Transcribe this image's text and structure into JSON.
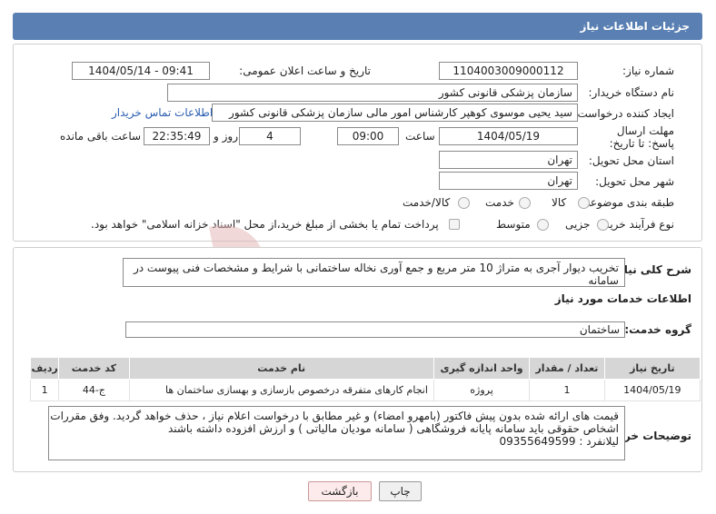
{
  "header": {
    "title": "جزئیات اطلاعات نیاز"
  },
  "form": {
    "need_number_label": "شماره نیاز:",
    "need_number": "1104003009000112",
    "announce_label": "تاریخ و ساعت اعلان عمومی:",
    "announce_value": "1404/05/14 - 09:41",
    "buyer_org_label": "نام دستگاه خریدار:",
    "buyer_org": "سازمان پزشکی قانونی کشور",
    "creator_label": "ایجاد کننده درخواست:",
    "creator": "سید یحیی موسوی کوهپر کارشناس امور مالی سازمان پزشکی قانونی کشور",
    "contact_link": "اطلاعات تماس خریدار",
    "deadline_label": "مهلت ارسال پاسخ: تا تاریخ:",
    "deadline_date": "1404/05/19",
    "time_label": "ساعت",
    "deadline_time": "09:00",
    "days_value": "4",
    "days_label": "روز و",
    "remaining_value": "22:35:49",
    "remaining_label": "ساعت باقی مانده",
    "province_label": "استان محل تحویل:",
    "province": "تهران",
    "city_label": "شهر محل تحویل:",
    "city": "تهران",
    "category_label": "طبقه بندی موضوعی:",
    "category_options": [
      "کالا",
      "خدمت",
      "کالا/خدمت"
    ],
    "process_label": "نوع فرآیند خرید :",
    "process_options": [
      "جزیی",
      "متوسط"
    ],
    "payment_note": "پرداخت تمام یا بخشی از مبلغ خرید،از محل \"اسناد خزانه اسلامی\" خواهد بود."
  },
  "details": {
    "summary_label": "شرح کلی نیاز:",
    "summary": "تخریب دیوار آجری به متراژ 10 متر مربع و جمع آوری نخاله ساختمانی با شرایط و مشخصات فنی  پیوست در سامانه",
    "services_title": "اطلاعات خدمات مورد نیاز",
    "group_label": "گروه خدمت:",
    "group_value": "ساختمان",
    "table": {
      "headers": [
        "ردیف",
        "کد خدمت",
        "نام خدمت",
        "واحد اندازه گیری",
        "تعداد / مقدار",
        "تاریخ نیاز"
      ],
      "rows": [
        [
          "1",
          "ج-44",
          "انجام کارهای متفرقه درخصوص بازسازی و بهسازی ساختمان ها",
          "پروژه",
          "1",
          "1404/05/19"
        ]
      ]
    },
    "buyer_notes_label": "توضیحات خریدار:",
    "buyer_notes": [
      "قیمت های ارائه شده بدون پیش فاکتور (بامهرو امضاء) و غیر مطابق با درخواست اعلام نیاز  ، حذف خواهد گردید. وفق مقررات",
      "اشخاص حقوقی باید سامانه پایانه فروشگاهی ( سامانه مودیان مالیاتی ) و ارزش افزوده  داشته باشند",
      "لیلانفرد  :   09355649599"
    ]
  },
  "buttons": {
    "print": "چاپ",
    "back": "بازگشت"
  },
  "colors": {
    "header": "#5a80b3",
    "link": "#2a5db0",
    "watermark": "#e7b9b9"
  }
}
